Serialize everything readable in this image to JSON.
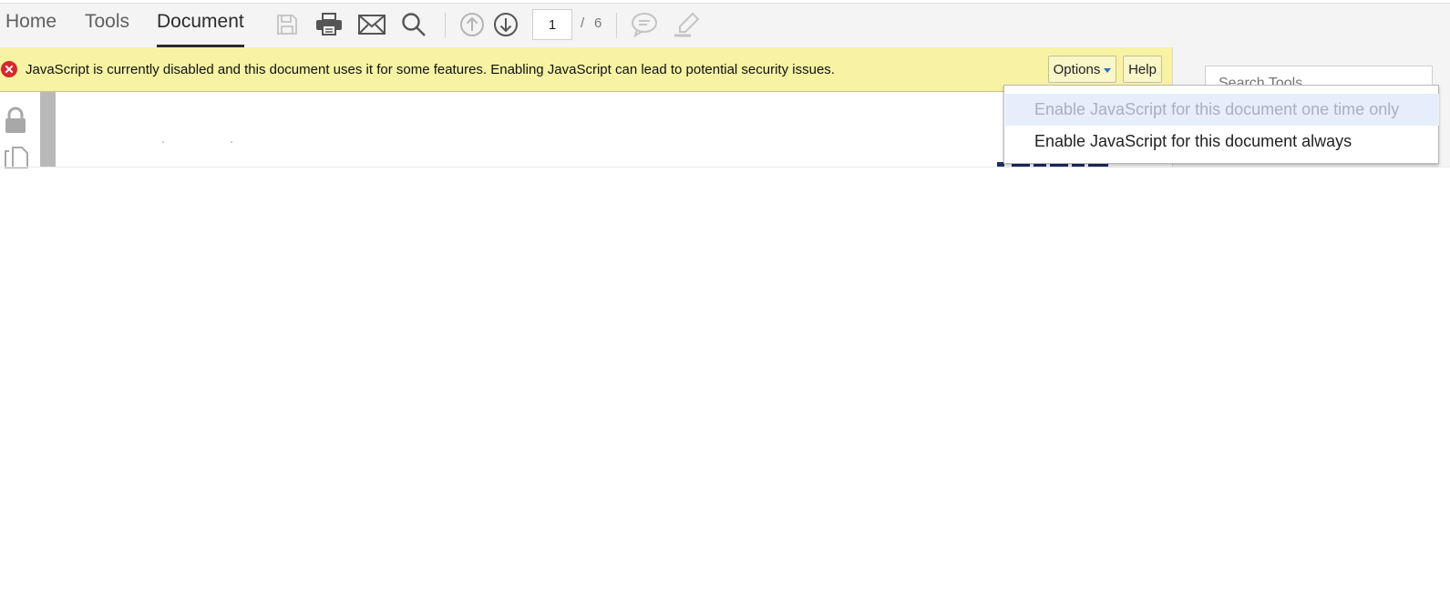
{
  "toolbar": {
    "tabs": [
      {
        "label": "Home"
      },
      {
        "label": "Tools"
      },
      {
        "label": "Document",
        "active": true
      }
    ],
    "icons": [
      "save-icon",
      "print-icon",
      "email-icon",
      "search-icon",
      "page-up-icon",
      "page-down-icon",
      "comment-icon",
      "highlight-icon"
    ],
    "page_current": "1",
    "page_separator": "/",
    "page_total": "6"
  },
  "banner": {
    "message": "JavaScript is currently disabled and this document uses it for some features. Enabling JavaScript can lead to potential security issues.",
    "options_label": "Options",
    "help_label": "Help",
    "background_color": "#f7f3a3",
    "error_color": "#d9262c"
  },
  "right_pane": {
    "search_placeholder": "Search Tools"
  },
  "dropdown": {
    "items": [
      {
        "label": "Enable JavaScript for this document one time only",
        "disabled": true
      },
      {
        "label": "Enable JavaScript for this document always",
        "disabled": false
      }
    ]
  },
  "left_rail": {
    "icons": [
      "lock-icon",
      "pages-icon"
    ]
  },
  "colors": {
    "toolbar_bg": "#f4f4f4",
    "dropdown_highlight": "#e6eefb",
    "accent_caret": "#2a6fc4",
    "heading_blue": "#1c2e63"
  }
}
